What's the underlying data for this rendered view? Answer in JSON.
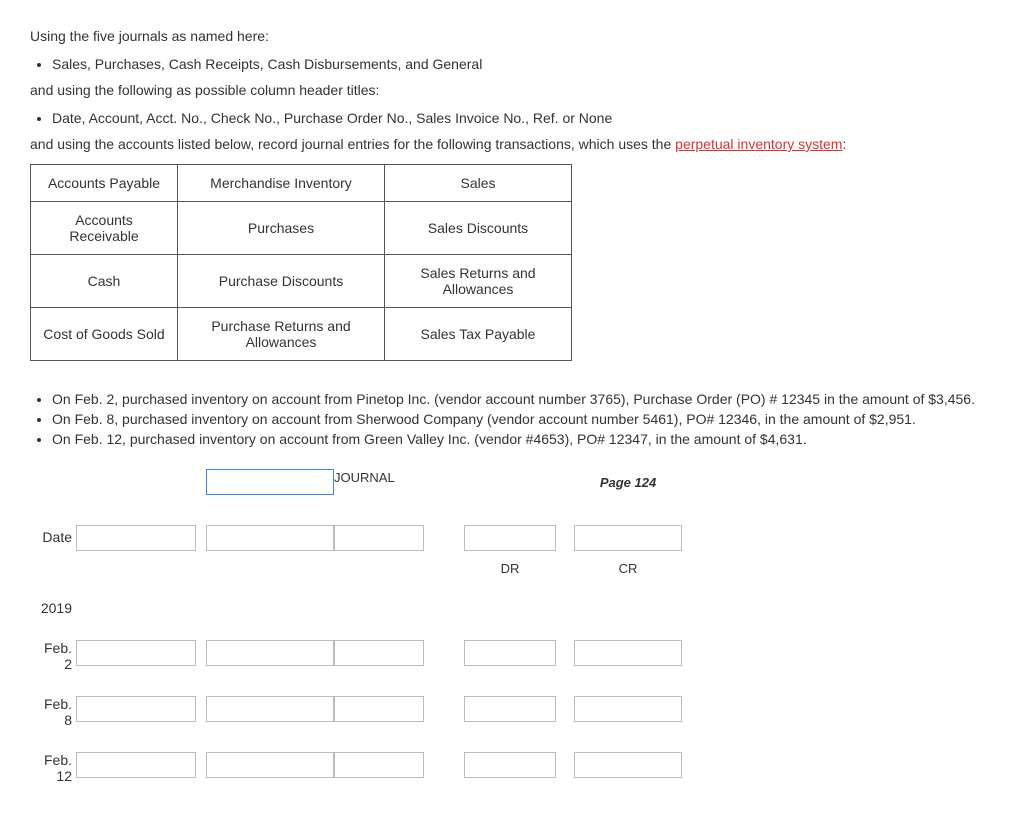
{
  "intro": {
    "line1": "Using the five journals as named here:",
    "bullet1": "Sales, Purchases, Cash Receipts, Cash Disbursements, and General",
    "line2": "and using the following as possible column header titles:",
    "bullet2": "Date, Account, Acct. No., Check No., Purchase Order No., Sales Invoice No., Ref. or None",
    "line3_pre": "and using the accounts listed below, record journal entries for the following transactions, which uses the ",
    "line3_link": "perpetual inventory system",
    "line3_post": ":"
  },
  "accounts_table": {
    "rows": [
      [
        "Accounts Payable",
        "Merchandise Inventory",
        "Sales"
      ],
      [
        "Accounts Receivable",
        "Purchases",
        "Sales Discounts"
      ],
      [
        "Cash",
        "Purchase Discounts",
        "Sales Returns and Allowances"
      ],
      [
        "Cost of Goods Sold",
        "Purchase Returns and Allowances",
        "Sales Tax Payable"
      ]
    ]
  },
  "transactions": [
    "On Feb. 2, purchased inventory on account from Pinetop Inc. (vendor account number 3765), Purchase Order (PO) # 12345 in the amount of $3,456.",
    "On Feb. 8, purchased inventory on account from Sherwood Company (vendor account number 5461), PO# 12346, in the amount of $2,951.",
    "On Feb. 12, purchased inventory on account from Green Valley Inc. (vendor #4653), PO# 12347, in the amount of $4,631."
  ],
  "journal": {
    "title_input_value": "",
    "journal_label": "JOURNAL",
    "page_label": "Page 124",
    "headers": {
      "date": "Date",
      "dr": "DR",
      "cr": "CR"
    },
    "year": "2019",
    "rows": [
      {
        "month": "Feb.",
        "day": "2"
      },
      {
        "month": "Feb.",
        "day": "8"
      },
      {
        "month": "Feb.",
        "day": "12"
      }
    ]
  }
}
